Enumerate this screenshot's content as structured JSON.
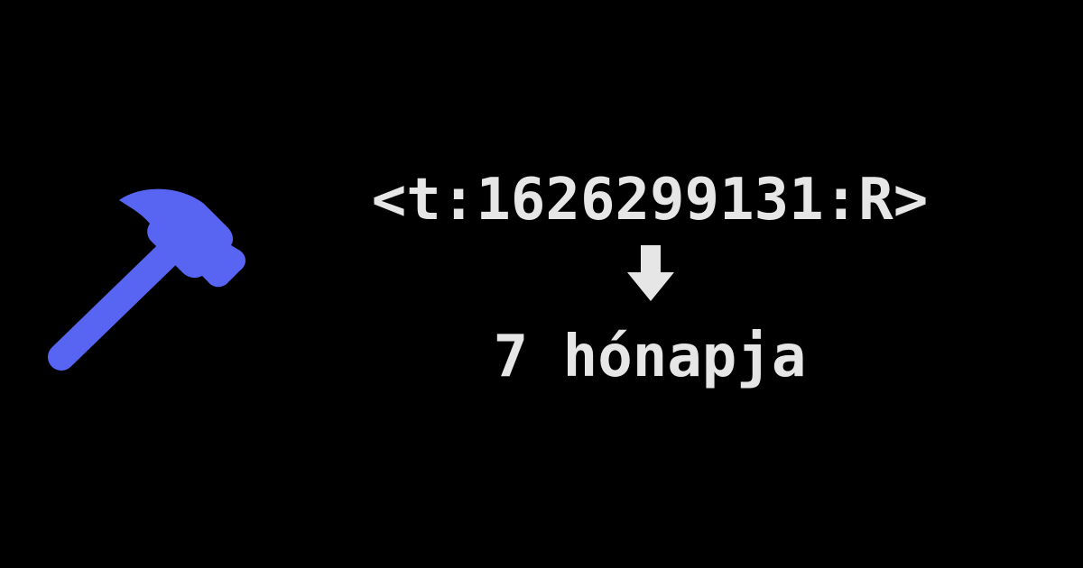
{
  "timestamp_syntax": "<t:1626299131:R>",
  "rendered_result": "7 hónapja",
  "icons": {
    "hammer": "hammer-icon",
    "arrow": "arrow-down-icon"
  },
  "colors": {
    "background": "#000000",
    "text": "#e6e6e6",
    "hammer": "#5865f2"
  }
}
